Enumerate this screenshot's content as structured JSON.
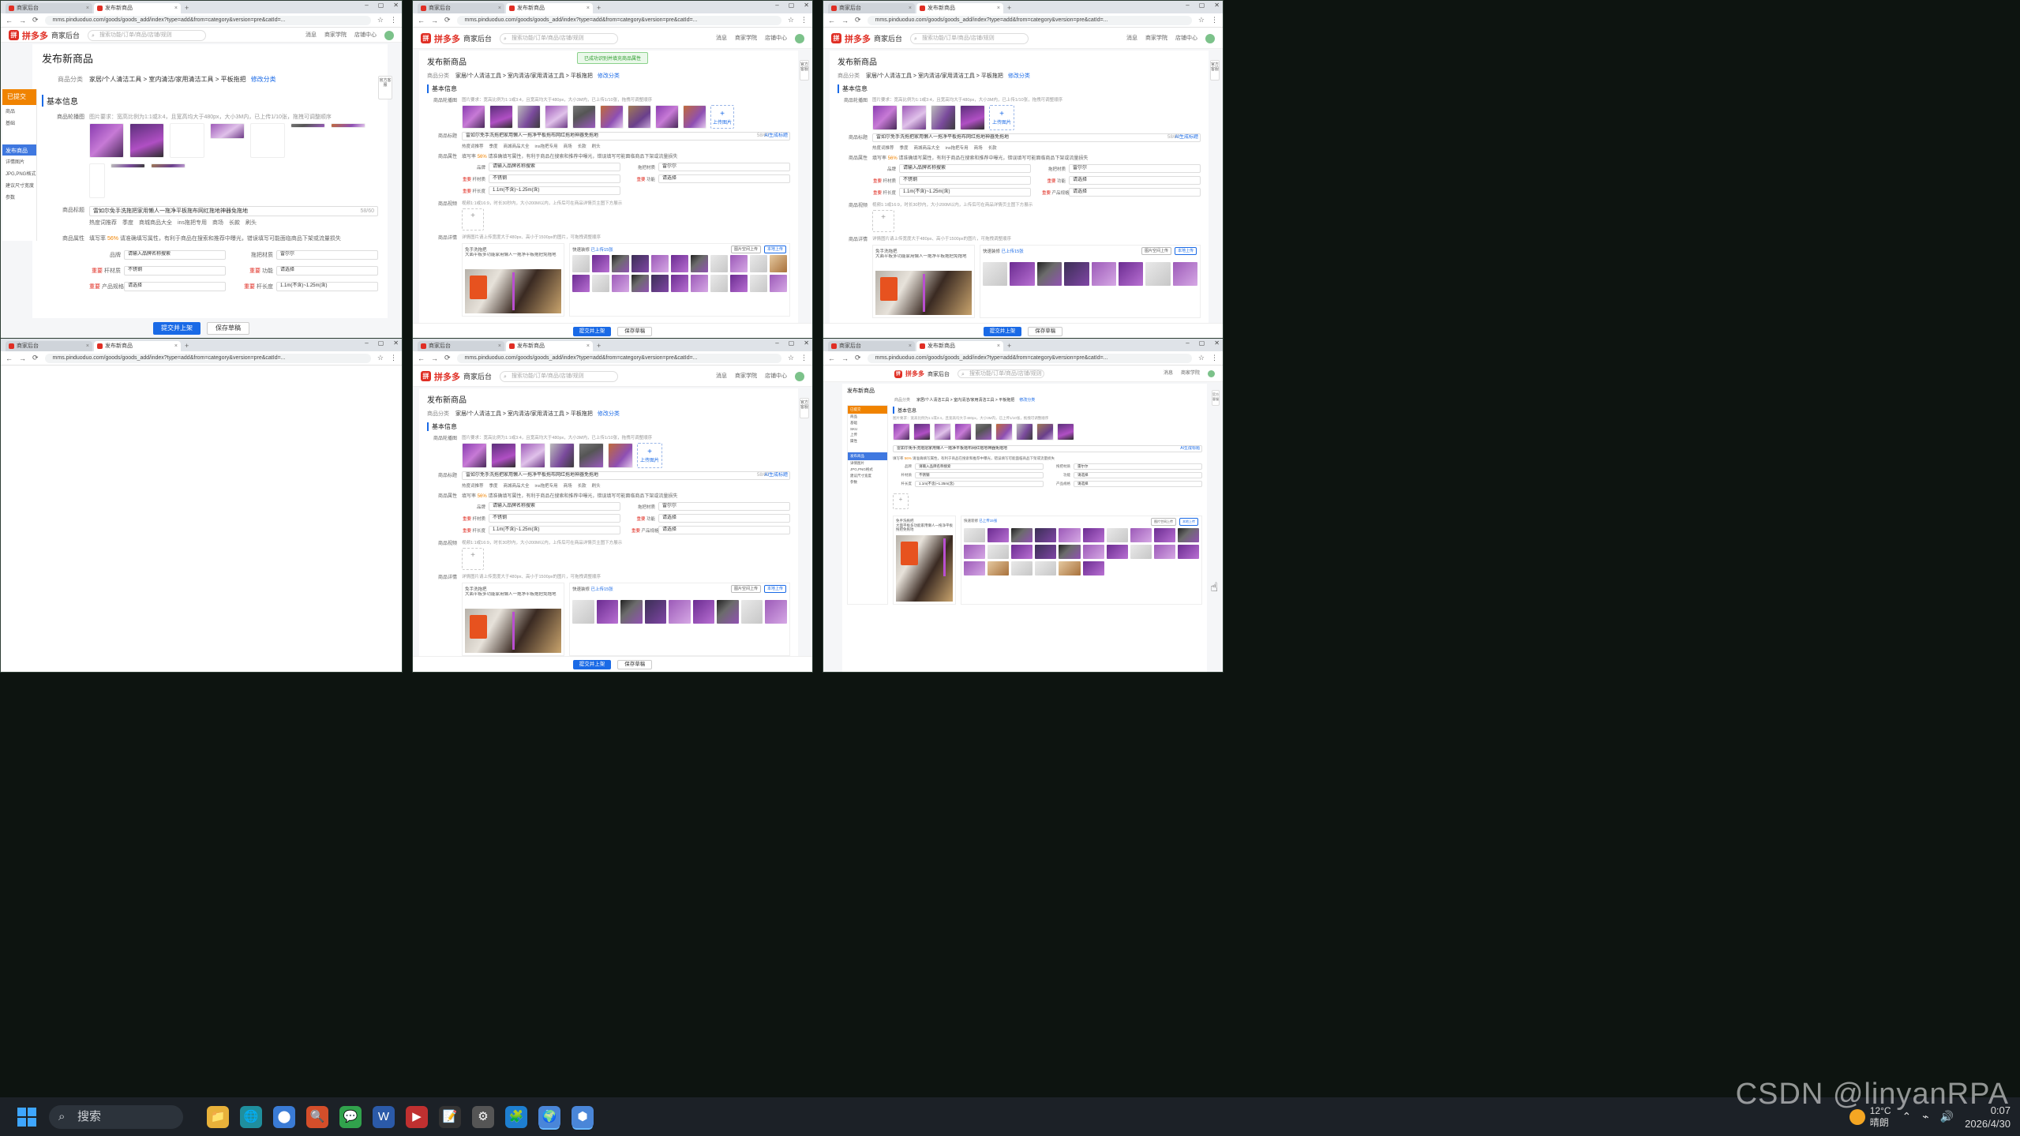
{
  "browser": {
    "tab_store": "商家后台",
    "tab_publish": "发布新商品",
    "tab_store_2": "商家后台",
    "tab_publish_2": "发布新商品",
    "new_tab": "+",
    "url": "mms.pinduoduo.com/goods/goods_add/index?type=add&from=category&version=pre&catId=..."
  },
  "app": {
    "brand": "拼多多",
    "sub": "商家后台",
    "search_placeholder": "搜索功能/订单/商品/店铺/规则",
    "header_icons": [
      "消息",
      "商家学院",
      "店铺中心",
      "客服"
    ]
  },
  "publish": {
    "title": "发布新商品",
    "category_label": "商品分类",
    "category_path": "家居/个人清洁工具 > 室内清洁/家用清洁工具 > 平板拖把",
    "category_change": "修改分类",
    "section_basic": "基本信息",
    "images_label": "商品轮播图",
    "images_hint": "图片要求：宽高比例为1:1或3:4，且宽高均大于480px，大小3M内，已上传1/10张，拖拽可调整顺序",
    "upload_label": "上传图片",
    "upload_plus": "+",
    "title_label": "商品标题",
    "title_value": "雷如尔免手洗拖把家用懒人一拖净平板拖布网红拖地神器免拖地",
    "title_count": "58/60",
    "title_ai": "AI生成标题",
    "title_chips": [
      "热度词推荐",
      "季度",
      "商城商品大全",
      "ins拖把专用",
      "商场",
      "长款",
      "刷头"
    ],
    "props_label": "商品属性",
    "props_fill": "填写率",
    "props_pct": "56%",
    "props_tip": "请准确填写属性，有利于商品在搜索和推荐中曝光，错误填写可能面临商品下架或流量损失",
    "props_sync": "同步至全部",
    "brand_label": "品牌",
    "brand_value": "请输入品牌名称搜索",
    "brand_hint": "中的找到商品品牌? 点击申请",
    "material_label": "拖把材质",
    "material_value": "雷尔尔",
    "rod_label": "杆材质",
    "rod_value": "不锈钢",
    "func_label": "功能",
    "func_value": "请选择",
    "origin_label": "产品规格",
    "origin_value": "请选择",
    "size_label": "杆长度",
    "size_value": "1.1m(不含)~1.25m(含)",
    "video_label": "商品视频",
    "video_hint": "视频1:1或16:9，时长30秒内，大小200M以内，上传后可在商品详情页主图下方展示",
    "detail_label": "商品详情",
    "detail_hint": "详情图片请上传宽度大于480px、高小于1500px的图片，可拖拽调整顺序",
    "detail_preview_title": "免手洗拖把",
    "detail_preview_text": "大面平板多功能家用懒人一拖净平板拖把免拖地",
    "detail_lib_title": "快速装修",
    "detail_lib_count": "已上传15张",
    "detail_btn_batch": "图片空间上传",
    "detail_btn_local": "本地上传",
    "submit": "提交并上架",
    "save_draft": "保存草稿",
    "side_float": "官方客服",
    "toast": "已成功识别并填充商品属性"
  },
  "left_panel": {
    "orange": "已提交",
    "items": [
      "商品",
      "基础",
      "SKU",
      "上传",
      "属性"
    ],
    "blue": "发布商品",
    "small": [
      "详情图片",
      "JPG,PNG格式",
      "建议尺寸宽度",
      "参数"
    ]
  },
  "taskbar": {
    "search": "搜索",
    "weather_temp": "12°C",
    "weather_text": "晴朗",
    "time": "0:07",
    "date": "2026/4/30",
    "apps": [
      "📁",
      "🌐",
      "⬤",
      "🔍",
      "💬",
      "W",
      "▶",
      "📝",
      "⚙",
      "🧩",
      "🌍",
      "⬢"
    ]
  },
  "watermark": "CSDN @linyanRPA",
  "colors": {
    "brand": "#e02e24",
    "primary": "#1a6ae6",
    "warning": "#f08300"
  }
}
